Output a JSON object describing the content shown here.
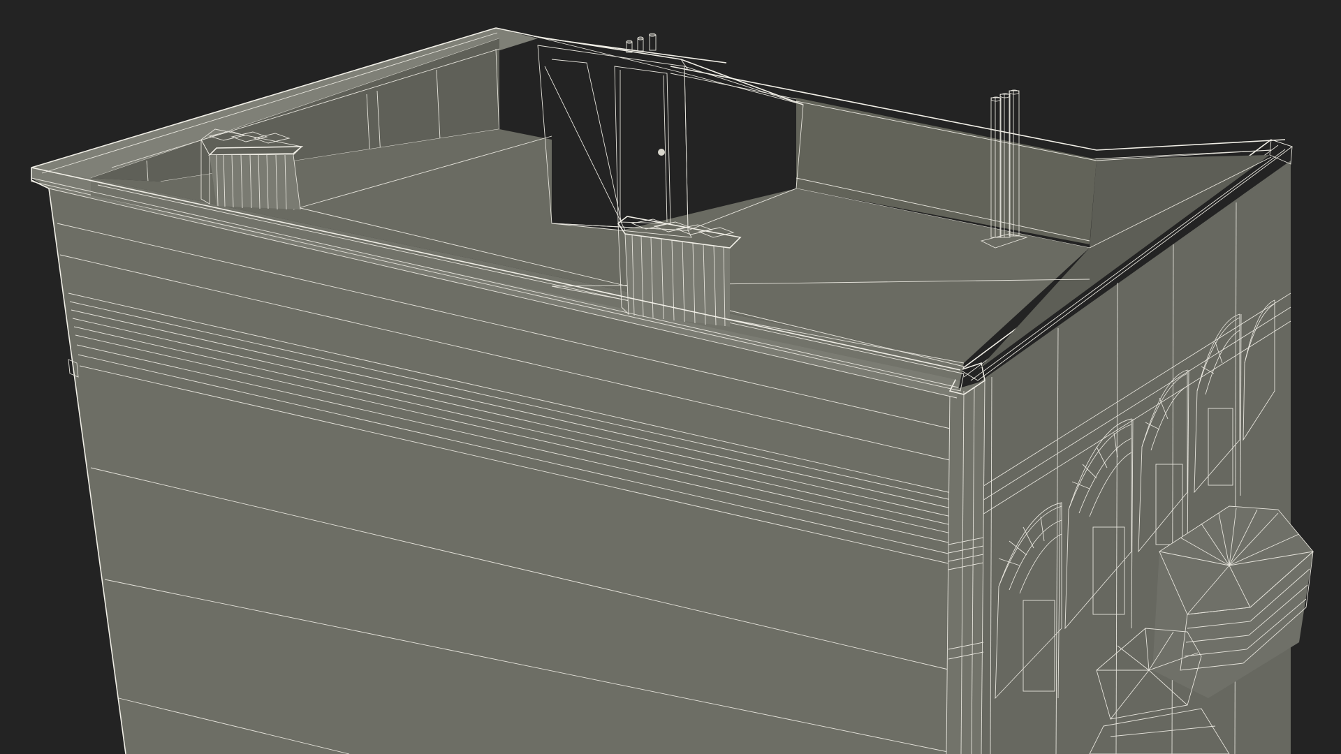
{
  "scene": {
    "subject": "building-rooftop-wireframe",
    "colors": {
      "background": "#232323",
      "wall": "#6e6f66",
      "wall_dark": "#5f6058",
      "roof_floor": "#6b6c63",
      "parapet_inner": "#64655c",
      "wireframe": "#e6e4dc"
    },
    "features": [
      "parapet-wall",
      "roof-access-door",
      "chimney-left",
      "chimney-center",
      "vent-pipes-left",
      "vent-pipes-right",
      "arched-windows",
      "bay-window-canopy"
    ]
  }
}
